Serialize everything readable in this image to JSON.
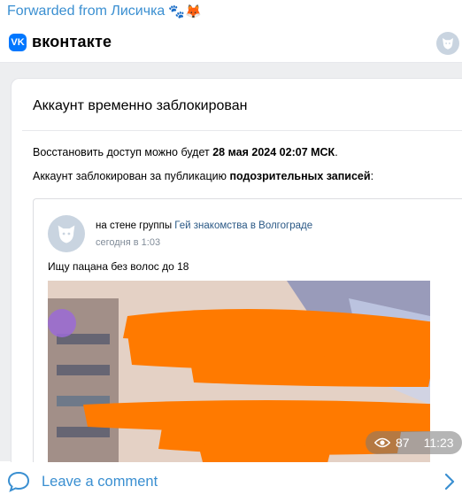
{
  "forwarded": {
    "text": "Forwarded from Лисичка",
    "emoji": "🐾🦊"
  },
  "header": {
    "logo_text": "VK",
    "brand": "вконтакте"
  },
  "notice": {
    "title": "Аккаунт временно заблокирован",
    "restore_prefix": "Восстановить доступ можно будет ",
    "restore_date": "28 мая 2024 02:07 МСК",
    "restore_suffix": ".",
    "reason_prefix": "Аккаунт заблокирован за публикацию ",
    "reason_bold": "подозрительных записей",
    "reason_suffix": ":"
  },
  "post": {
    "meta_prefix": "на стене группы ",
    "group_name": "Гей знакомства в Волгограде",
    "time": "сегодня в 1:03",
    "text": "Ищу пацана без волос до 18"
  },
  "overlay": {
    "views": "87",
    "time": "11:23"
  },
  "footer": {
    "comment_label": "Leave a comment"
  },
  "colors": {
    "accent": "#3a8fd1",
    "vk_blue": "#0077ff",
    "redaction": "#ff7a00"
  },
  "icons": [
    "paw-emoji",
    "fox-emoji",
    "vk-logo-icon",
    "default-avatar-icon",
    "eye-icon",
    "comment-icon",
    "chevron-right-icon"
  ]
}
